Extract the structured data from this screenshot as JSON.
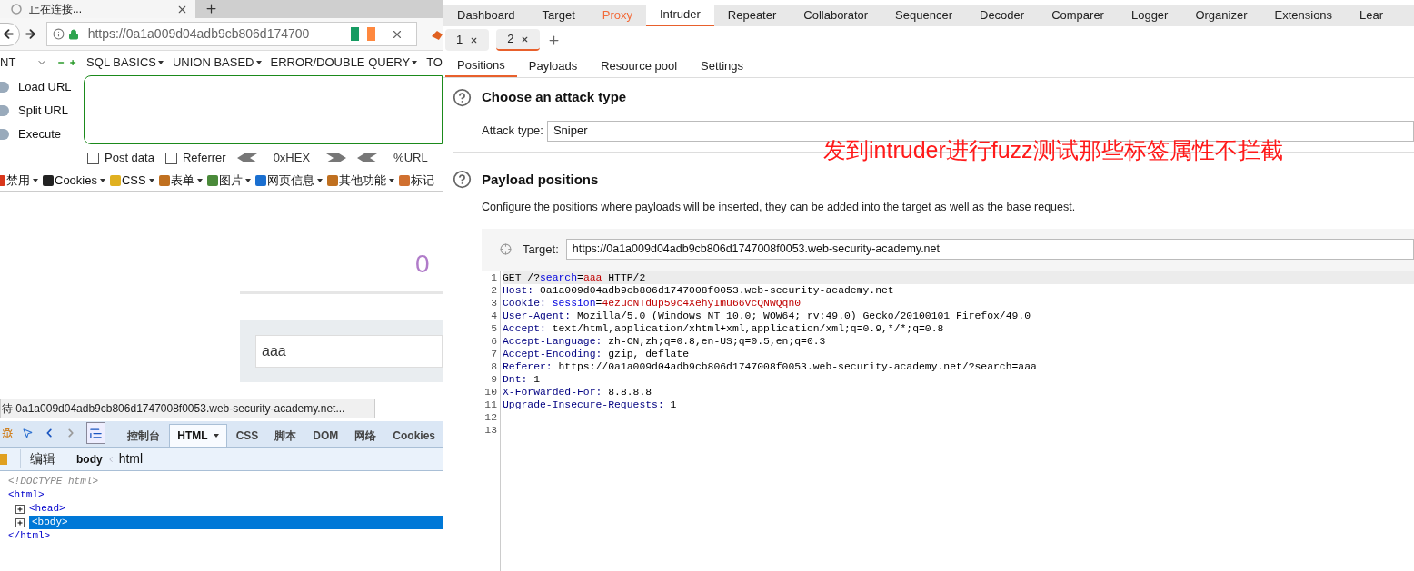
{
  "browser": {
    "tab": {
      "title": "止在连接..."
    },
    "address_bar": {
      "url": "https://0a1a009d04adb9cb806d174700"
    },
    "hackbar": {
      "select": "NT",
      "menus": [
        {
          "label": "SQL BASICS",
          "caret": true
        },
        {
          "label": "UNION BASED",
          "caret": true
        },
        {
          "label": "ERROR/DOUBLE QUERY",
          "caret": true
        },
        {
          "label": "TO",
          "caret": false
        }
      ],
      "actions": [
        "Load URL",
        "Split URL",
        "Execute"
      ],
      "options": [
        {
          "label": "Post data",
          "checked": false
        },
        {
          "label": "Referrer",
          "checked": false
        }
      ],
      "encoders": [
        "0xHEX",
        "%URL"
      ]
    },
    "dev_toolbar": [
      "禁用",
      "Cookies",
      "CSS",
      "表单",
      "图片",
      "网页信息",
      "其他功能",
      "标记"
    ],
    "page": {
      "heading": "0",
      "search_value": "aaa"
    },
    "status": "待 0a1a009d04adb9cb806d1747008f0053.web-security-academy.net...",
    "devtools": {
      "tabs": [
        {
          "label": "控制台",
          "selected": false
        },
        {
          "label": "HTML",
          "selected": true
        },
        {
          "label": "CSS",
          "selected": false
        },
        {
          "label": "脚本",
          "selected": false
        },
        {
          "label": "DOM",
          "selected": false
        },
        {
          "label": "网络",
          "selected": false
        },
        {
          "label": "Cookies",
          "selected": false
        }
      ],
      "edit": "编辑",
      "breadcrumb": [
        "body",
        "html"
      ],
      "tree": [
        {
          "kind": "doctype",
          "text": "<!DOCTYPE html>"
        },
        {
          "kind": "element",
          "text": "<html>",
          "children": [
            {
              "text": "<head>",
              "expanded": false,
              "selected": false
            },
            {
              "text": "<body>",
              "expanded": false,
              "selected": true
            }
          ]
        },
        {
          "kind": "close",
          "text": "</html>"
        }
      ]
    }
  },
  "burp": {
    "tabs": [
      {
        "label": "Dashboard",
        "selected": false,
        "highlighted": false
      },
      {
        "label": "Target",
        "selected": false,
        "highlighted": false
      },
      {
        "label": "Proxy",
        "selected": false,
        "highlighted": true
      },
      {
        "label": "Intruder",
        "selected": true,
        "highlighted": false
      },
      {
        "label": "Repeater",
        "selected": false,
        "highlighted": false
      },
      {
        "label": "Collaborator",
        "selected": false,
        "highlighted": false
      },
      {
        "label": "Sequencer",
        "selected": false,
        "highlighted": false
      },
      {
        "label": "Decoder",
        "selected": false,
        "highlighted": false
      },
      {
        "label": "Comparer",
        "selected": false,
        "highlighted": false
      },
      {
        "label": "Logger",
        "selected": false,
        "highlighted": false
      },
      {
        "label": "Organizer",
        "selected": false,
        "highlighted": false
      },
      {
        "label": "Extensions",
        "selected": false,
        "highlighted": false
      },
      {
        "label": "Lear",
        "selected": false,
        "highlighted": false
      }
    ],
    "request_tabs": [
      {
        "label": "1",
        "selected": false
      },
      {
        "label": "2",
        "selected": true
      }
    ],
    "sub_tabs": [
      {
        "label": "Positions",
        "selected": true
      },
      {
        "label": "Payloads",
        "selected": false
      },
      {
        "label": "Resource pool",
        "selected": false
      },
      {
        "label": "Settings",
        "selected": false
      }
    ],
    "attack": {
      "title": "Choose an attack type",
      "label": "Attack type:",
      "value": "Sniper"
    },
    "annotation": "发到intruder进行fuzz测试那些标签属性不拦截",
    "positions": {
      "title": "Payload positions",
      "description": "Configure the positions where payloads will be inserted, they can be added into the target as well as the base request.",
      "target_label": "Target:",
      "target": "https://0a1a009d04adb9cb806d1747008f0053.web-security-academy.net"
    },
    "request": [
      {
        "number": "1",
        "segments": [
          {
            "kind": "plain",
            "text": "GET /?"
          },
          {
            "kind": "param",
            "text": "search"
          },
          {
            "kind": "plain",
            "text": "="
          },
          {
            "kind": "value",
            "text": "aaa"
          },
          {
            "kind": "plain",
            "text": " HTTP/2"
          }
        ]
      },
      {
        "number": "2",
        "segments": [
          {
            "kind": "header",
            "text": "Host:"
          },
          {
            "kind": "plain",
            "text": " 0a1a009d04adb9cb806d1747008f0053.web-security-academy.net"
          }
        ]
      },
      {
        "number": "3",
        "segments": [
          {
            "kind": "header",
            "text": "Cookie:"
          },
          {
            "kind": "param",
            "text": " session"
          },
          {
            "kind": "plain",
            "text": "="
          },
          {
            "kind": "value",
            "text": "4ezucNTdup59c4XehyImu66vcQNWQqn0"
          }
        ]
      },
      {
        "number": "4",
        "segments": [
          {
            "kind": "header",
            "text": "User-Agent:"
          },
          {
            "kind": "plain",
            "text": " Mozilla/5.0 (Windows NT 10.0; WOW64; rv:49.0) Gecko/20100101 Firefox/49.0"
          }
        ]
      },
      {
        "number": "5",
        "segments": [
          {
            "kind": "header",
            "text": "Accept:"
          },
          {
            "kind": "plain",
            "text": " text/html,application/xhtml+xml,application/xml;q=0.9,*/*;q=0.8"
          }
        ]
      },
      {
        "number": "6",
        "segments": [
          {
            "kind": "header",
            "text": "Accept-Language:"
          },
          {
            "kind": "plain",
            "text": " zh-CN,zh;q=0.8,en-US;q=0.5,en;q=0.3"
          }
        ]
      },
      {
        "number": "7",
        "segments": [
          {
            "kind": "header",
            "text": "Accept-Encoding:"
          },
          {
            "kind": "plain",
            "text": " gzip, deflate"
          }
        ]
      },
      {
        "number": "8",
        "segments": [
          {
            "kind": "header",
            "text": "Referer:"
          },
          {
            "kind": "plain",
            "text": " https://0a1a009d04adb9cb806d1747008f0053.web-security-academy.net/?search=aaa"
          }
        ]
      },
      {
        "number": "9",
        "segments": [
          {
            "kind": "header",
            "text": "Dnt:"
          },
          {
            "kind": "plain",
            "text": " 1"
          }
        ]
      },
      {
        "number": "10",
        "segments": [
          {
            "kind": "header",
            "text": "X-Forwarded-For:"
          },
          {
            "kind": "plain",
            "text": " 8.8.8.8"
          }
        ]
      },
      {
        "number": "11",
        "segments": [
          {
            "kind": "header",
            "text": "Upgrade-Insecure-Requests:"
          },
          {
            "kind": "plain",
            "text": " 1"
          }
        ]
      },
      {
        "number": "12"
      },
      {
        "number": "13"
      }
    ]
  }
}
